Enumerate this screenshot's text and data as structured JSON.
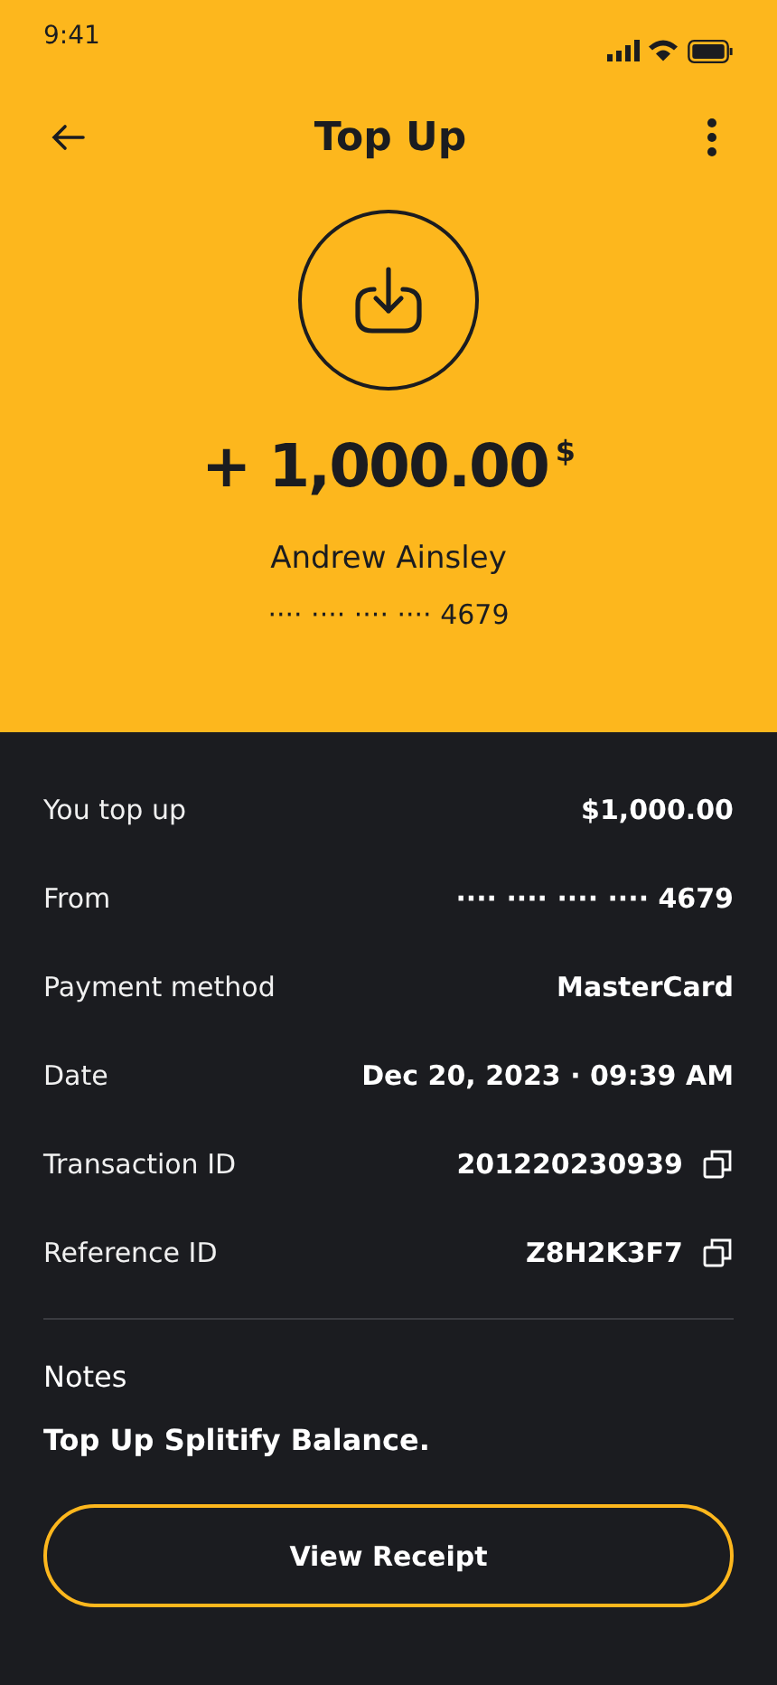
{
  "status_bar": {
    "time": "9:41"
  },
  "header": {
    "title": "Top Up"
  },
  "summary": {
    "amount": "+ 1,000.00",
    "currency": "$",
    "name": "Andrew Ainsley",
    "card": "···· ···· ···· ···· 4679"
  },
  "details": [
    {
      "label": "You top up",
      "value": "$1,000.00",
      "kind": "text"
    },
    {
      "label": "From",
      "value": "···· ···· ···· ···· 4679",
      "kind": "text"
    },
    {
      "label": "Payment method",
      "value": "MasterCard",
      "kind": "text"
    },
    {
      "label": "Date",
      "value": "Dec 20, 2023 · 09:39 AM",
      "kind": "text"
    },
    {
      "label": "Transaction ID",
      "value": "201220230939",
      "kind": "copy"
    },
    {
      "label": "Reference ID",
      "value": "Z8H2K3F7",
      "kind": "copy"
    }
  ],
  "notes": {
    "label": "Notes",
    "text": "Top Up Splitify Balance."
  },
  "button": "View Receipt"
}
